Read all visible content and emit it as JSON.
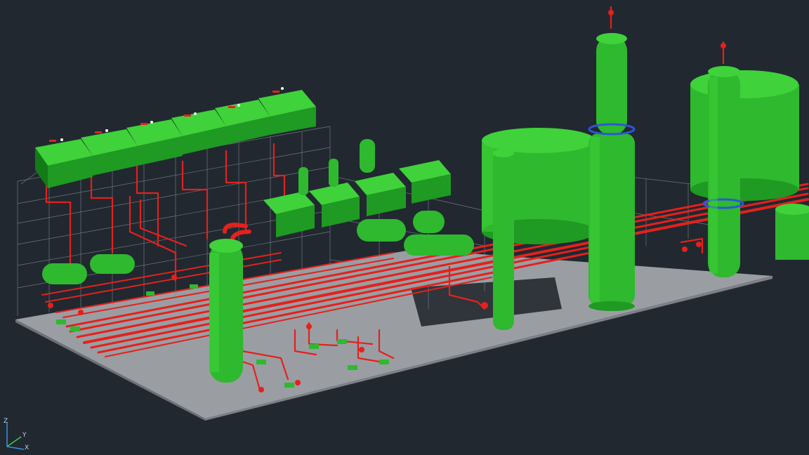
{
  "viewport": {
    "background": "#212830",
    "colors": {
      "equipment": "#24a624",
      "equipment_dark": "#107a16",
      "equipment_light": "#3fd23a",
      "piping": "#e4211c",
      "piping_dark": "#a0120f",
      "slab": "#9a9ea3",
      "slab_edge": "#6e7278",
      "steel_wireframe": "#8a9099",
      "platform_blue": "#2c57d6"
    }
  },
  "ucs_icon": {
    "icon": "ucs-axis-icon",
    "x_label": "X",
    "y_label": "Y",
    "z_label": "Z",
    "x_color": "#3c8fe0",
    "y_color": "#42c84a",
    "z_color": "#3c8fe0"
  }
}
